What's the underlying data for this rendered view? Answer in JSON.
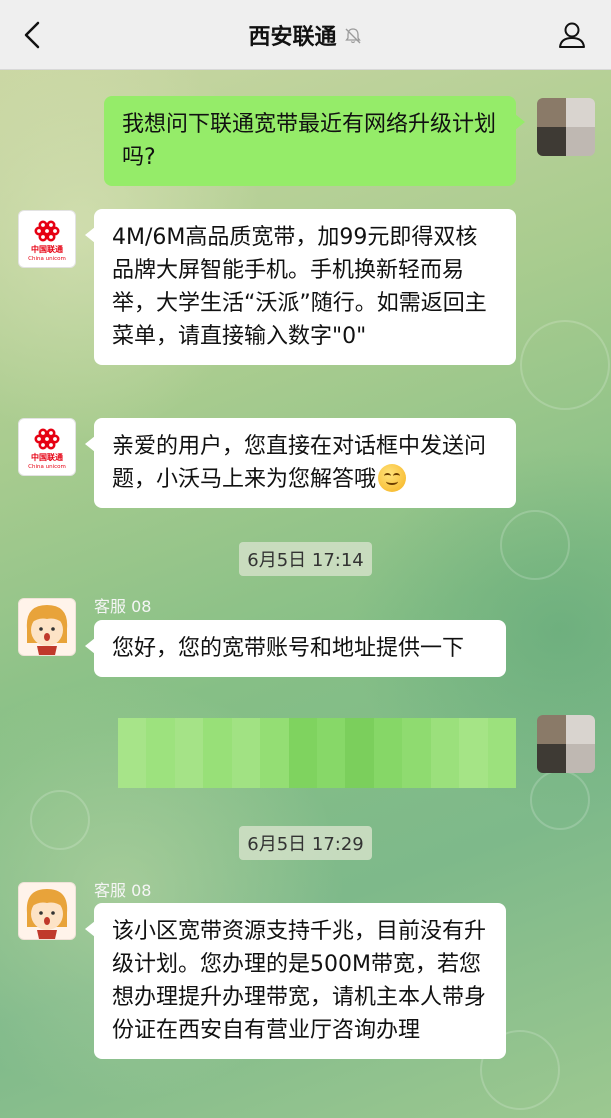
{
  "header": {
    "title": "西安联通"
  },
  "icons": {
    "back": "chevron-left-icon",
    "mute": "bell-off-icon",
    "profile": "person-icon"
  },
  "messages": {
    "m1": {
      "text": "我想问下联通宽带最近有网络升级计划吗?"
    },
    "m2": {
      "text": "4M/6M高品质宽带，加99元即得双核品牌大屏智能手机。手机换新轻而易举，大学生活“沃派”随行。如需返回主菜单，请直接输入数字\"0\""
    },
    "m3": {
      "text": "亲爱的用户，您直接在对话框中发送问题，小沃马上来为您解答哦"
    },
    "ts1": "6月5日 17:14",
    "m4": {
      "sender": "客服 08",
      "text": "您好，您的宽带账号和地址提供一下"
    },
    "ts2": "6月5日 17:29",
    "m5": {
      "sender": "客服 08",
      "text": "该小区宽带资源支持千兆，目前没有升级计划。您办理的是500M带宽，若您想办理提升办理带宽，请机主本人带身份证在西安自有营业厅咨询办理"
    }
  },
  "avatars": {
    "unicom_logo_text_cn": "中国联通",
    "unicom_logo_text_en": "China unicom"
  },
  "colors": {
    "nav_bg": "#efefef",
    "bubble_self": "#95ec69",
    "bubble_other": "#ffffff",
    "unicom_red": "#e60012"
  }
}
